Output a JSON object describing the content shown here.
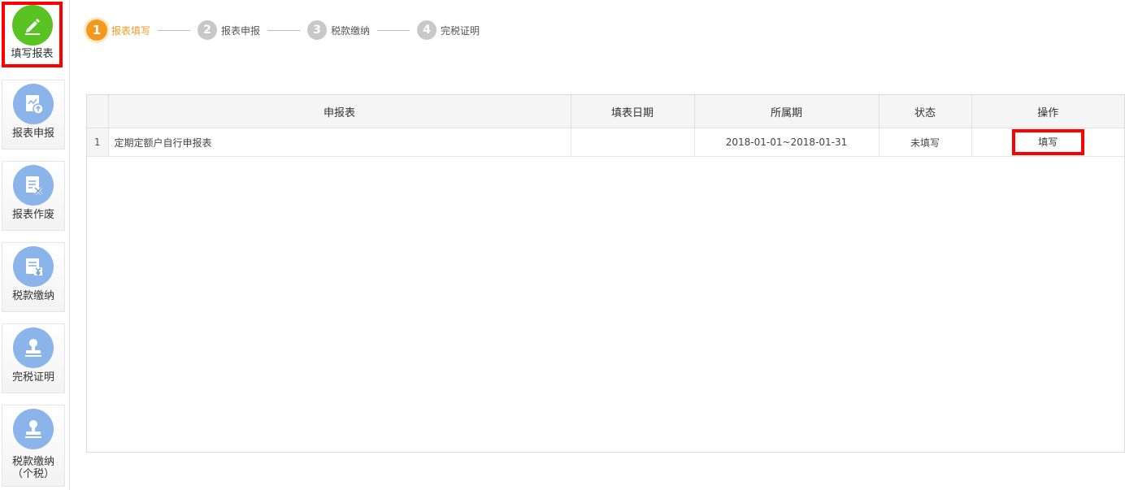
{
  "sidebar": {
    "items": [
      {
        "label": "填写报表",
        "icon": "pencil-icon",
        "active": true
      },
      {
        "label": "报表申报",
        "icon": "report-upload-icon"
      },
      {
        "label": "报表作废",
        "icon": "report-void-icon"
      },
      {
        "label": "税款缴纳",
        "icon": "tax-payment-icon"
      },
      {
        "label": "完税证明",
        "icon": "stamp-icon"
      },
      {
        "label": "税款缴纳",
        "label2": "（个税）",
        "icon": "stamp-icon"
      }
    ]
  },
  "steps": [
    {
      "num": "1",
      "label": "报表填写",
      "active": true
    },
    {
      "num": "2",
      "label": "报表申报"
    },
    {
      "num": "3",
      "label": "税款缴纳"
    },
    {
      "num": "4",
      "label": "完税证明"
    }
  ],
  "table": {
    "columns": [
      "",
      "申报表",
      "填表日期",
      "所属期",
      "状态",
      "操作"
    ],
    "rows": [
      {
        "index": "1",
        "form": "定期定额户自行申报表",
        "fill_date": "",
        "period": "2018-01-01~2018-01-31",
        "status": "未填写",
        "action": "填写"
      }
    ]
  },
  "colors": {
    "active_green": "#58c322",
    "icon_blue": "#8ab4ea",
    "step_orange": "#f39a1e",
    "highlight_red": "#ff0000"
  }
}
